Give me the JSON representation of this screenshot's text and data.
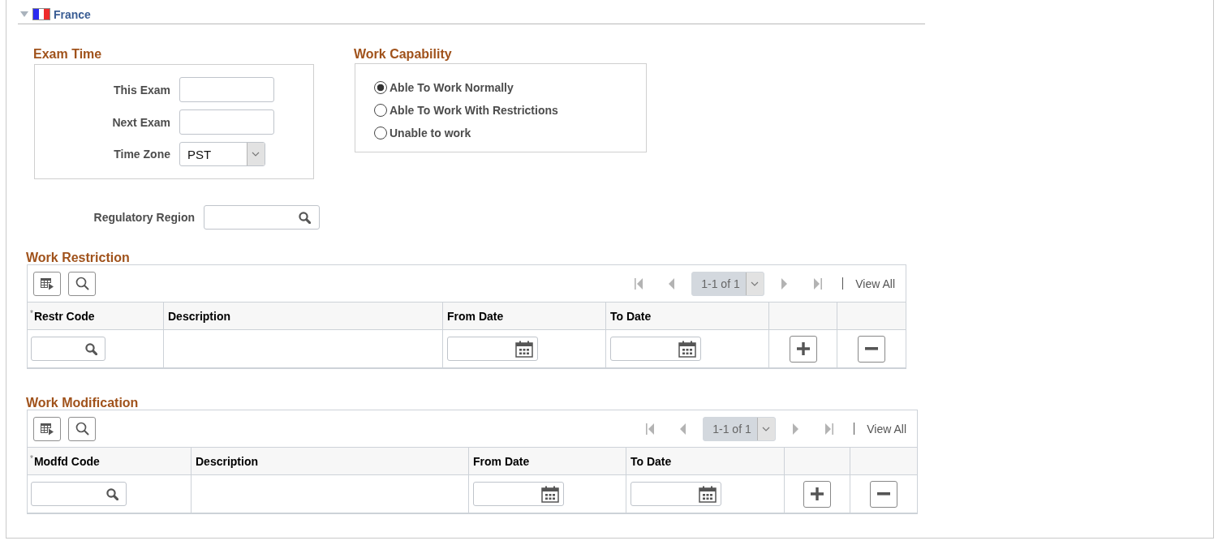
{
  "section": {
    "title": "France",
    "expanded": true
  },
  "exam_time": {
    "title": "Exam Time",
    "fields": [
      {
        "kind": "text",
        "label": "This Exam"
      },
      {
        "kind": "text",
        "label": "Next Exam"
      },
      {
        "kind": "select",
        "label": "Time Zone",
        "value": "PST"
      }
    ]
  },
  "work_capability": {
    "title": "Work Capability",
    "options": [
      {
        "label": "Able To Work Normally",
        "selected": true
      },
      {
        "label": "Able To Work With Restrictions",
        "selected": false
      },
      {
        "label": "Unable to work",
        "selected": false
      }
    ]
  },
  "regulatory_region": {
    "label": "Regulatory Region"
  },
  "grids": [
    {
      "title": "Work Restriction",
      "pager": {
        "range": "1-1 of 1",
        "disabled": true,
        "link": "View All"
      },
      "columns": [
        {
          "kind": "lookup",
          "label": "Restr Code",
          "required_mark": "*"
        },
        {
          "kind": "text",
          "label": "Description"
        },
        {
          "kind": "date",
          "label": "From Date"
        },
        {
          "kind": "date",
          "label": "To Date"
        },
        {
          "kind": "add"
        },
        {
          "kind": "delete"
        }
      ]
    },
    {
      "title": "Work Modification",
      "pager": {
        "range": "1-1 of 1",
        "disabled": true,
        "link": "View All"
      },
      "columns": [
        {
          "kind": "lookup",
          "label": "Modfd Code",
          "required_mark": "*"
        },
        {
          "kind": "text",
          "label": "Description"
        },
        {
          "kind": "date",
          "label": "From Date"
        },
        {
          "kind": "date",
          "label": "To Date"
        },
        {
          "kind": "add"
        },
        {
          "kind": "delete"
        }
      ]
    }
  ]
}
